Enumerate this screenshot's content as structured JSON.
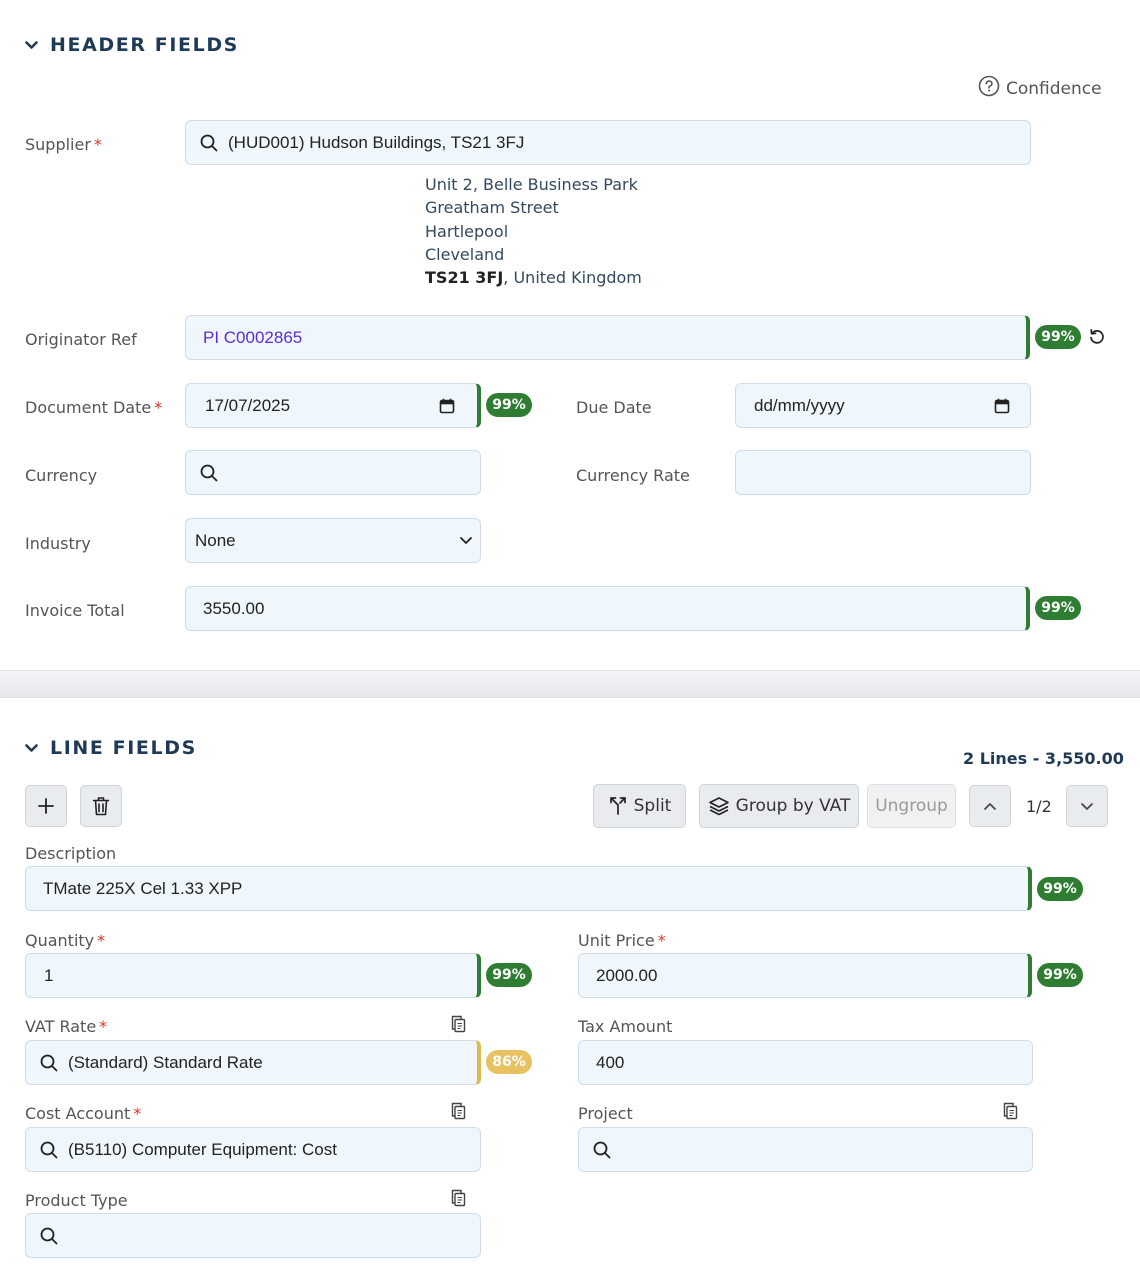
{
  "header_section": {
    "title": "HEADER FIELDS",
    "confidence_label": "Confidence",
    "supplier": {
      "label": "Supplier",
      "value": "(HUD001) Hudson Buildings, TS21 3FJ",
      "address_lines": [
        "Unit 2, Belle Business Park",
        "Greatham Street",
        "Hartlepool",
        "Cleveland"
      ],
      "address_postcode": "TS21 3FJ",
      "address_country": ", United Kingdom"
    },
    "originator_ref": {
      "label": "Originator Ref",
      "value": "PI C0002865",
      "confidence": "99%"
    },
    "document_date": {
      "label": "Document Date",
      "value": "17/07/2025",
      "confidence": "99%"
    },
    "due_date": {
      "label": "Due Date",
      "placeholder": "dd/mm/yyyy"
    },
    "currency": {
      "label": "Currency",
      "value": ""
    },
    "currency_rate": {
      "label": "Currency Rate",
      "value": ""
    },
    "industry": {
      "label": "Industry",
      "selected": "None"
    },
    "invoice_total": {
      "label": "Invoice Total",
      "value": "3550.00",
      "confidence": "99%"
    }
  },
  "line_section": {
    "title": "LINE FIELDS",
    "summary": "2 Lines - 3,550.00",
    "toolbar": {
      "split_label": "Split",
      "group_vat_label": "Group by VAT",
      "ungroup_label": "Ungroup",
      "pager": "1/2"
    },
    "description": {
      "label": "Description",
      "value": "TMate 225X Cel 1.33 XPP",
      "confidence": "99%"
    },
    "quantity": {
      "label": "Quantity",
      "value": "1",
      "confidence": "99%"
    },
    "unit_price": {
      "label": "Unit Price",
      "value": "2000.00",
      "confidence": "99%"
    },
    "vat_rate": {
      "label": "VAT Rate",
      "value": "(Standard) Standard Rate",
      "confidence": "86%"
    },
    "tax_amount": {
      "label": "Tax Amount",
      "value": "400"
    },
    "cost_account": {
      "label": "Cost Account",
      "value": "(B5110) Computer Equipment: Cost"
    },
    "project": {
      "label": "Project",
      "value": ""
    },
    "product_type": {
      "label": "Product Type",
      "value": ""
    }
  },
  "colors": {
    "accent_dark": "#1f3a56",
    "confidence_high": "#2e7d32",
    "confidence_medium": "#e8c262",
    "required": "#d9342b",
    "field_bg": "#f0f7fc"
  },
  "icons": [
    "chevron-down-icon",
    "help-circle-icon",
    "search-icon",
    "calendar-icon",
    "undo-icon",
    "plus-icon",
    "trash-icon",
    "split-icon",
    "layers-icon",
    "chevron-up-icon",
    "copy-icon"
  ]
}
